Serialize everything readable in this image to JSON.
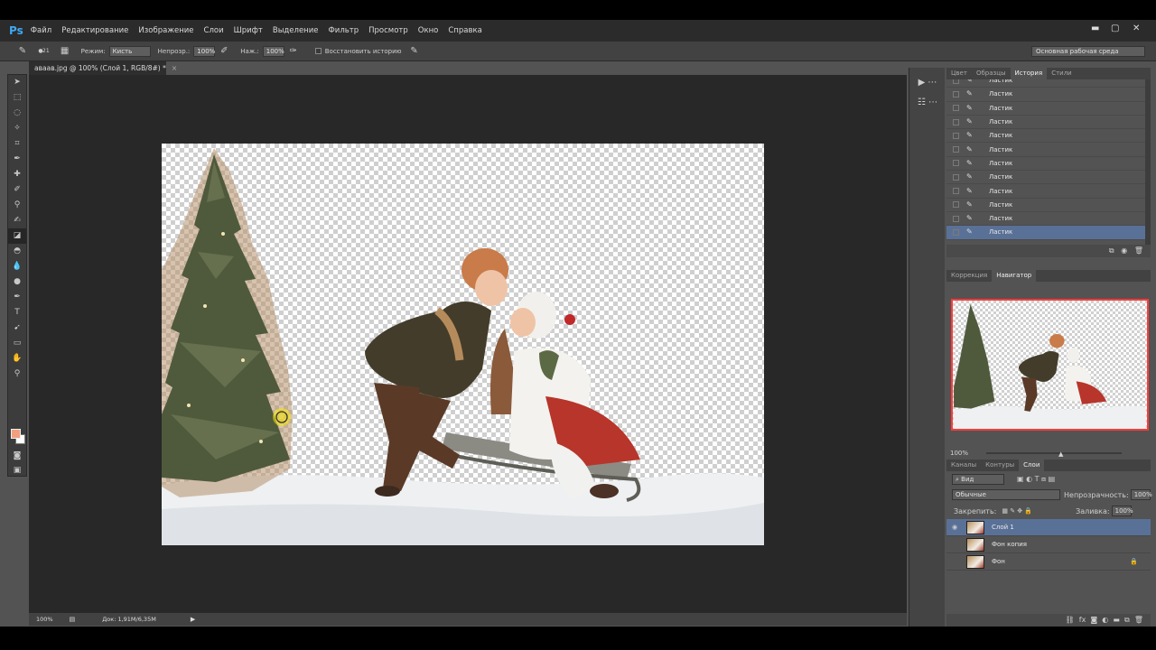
{
  "menubar": {
    "logo": "Ps",
    "items": [
      "Файл",
      "Редактирование",
      "Изображение",
      "Слои",
      "Шрифт",
      "Выделение",
      "Фильтр",
      "Просмотр",
      "Окно",
      "Справка"
    ]
  },
  "options": {
    "brush_size": "21",
    "mode_label": "Режим:",
    "mode_value": "Кисть",
    "opacity_label": "Непрозр.:",
    "opacity_value": "100%",
    "pressure_label": "Наж.:",
    "pressure_value": "100%",
    "restore_label": "Восстановить историю",
    "workspace": "Основная рабочая среда"
  },
  "document": {
    "tab_title": "аваав.jpg @ 100% (Слой 1, RGB/8#) *",
    "zoom": "100%",
    "doc_size": "Док: 1,91M/6,35M"
  },
  "history_panel": {
    "tabs": [
      "Цвет",
      "Образцы",
      "История",
      "Стили"
    ],
    "active_tab": "История",
    "items": [
      "Ластик",
      "Ластик",
      "Ластик",
      "Ластик",
      "Ластик",
      "Ластик",
      "Ластик",
      "Ластик",
      "Ластик",
      "Ластик",
      "Ластик",
      "Ластик"
    ]
  },
  "navigator_panel": {
    "tabs": [
      "Коррекция",
      "Навигатор"
    ],
    "active_tab": "Навигатор",
    "zoom": "100%"
  },
  "layers_panel": {
    "tabs": [
      "Каналы",
      "Контуры",
      "Слои"
    ],
    "active_tab": "Слои",
    "filter": "Вид",
    "blend_mode": "Обычные",
    "opacity_label": "Непрозрачность:",
    "opacity_value": "100%",
    "lock_label": "Закрепить:",
    "fill_label": "Заливка:",
    "fill_value": "100%",
    "layers": [
      {
        "name": "Слой 1",
        "visible": true,
        "selected": true
      },
      {
        "name": "Фон копия",
        "visible": false,
        "selected": false
      },
      {
        "name": "Фон",
        "visible": false,
        "selected": false,
        "locked": true
      }
    ]
  },
  "colors": {
    "foreground": "#f0a07e",
    "background": "#ffffff",
    "selection": "#5a7197"
  }
}
